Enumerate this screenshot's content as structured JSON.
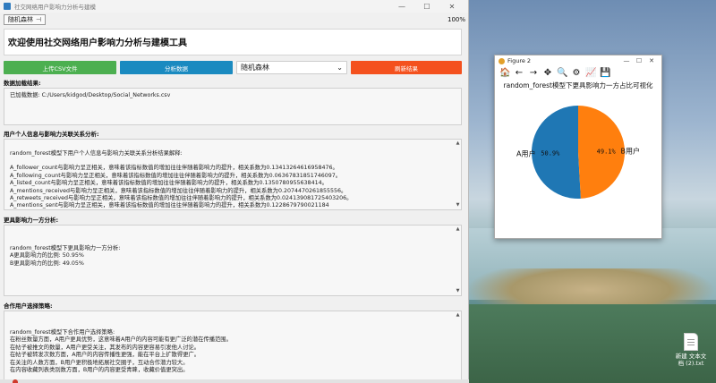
{
  "window": {
    "title": "社交网络用户影响力分析与建模",
    "minimize": "—",
    "maximize": "☐",
    "close": "✕"
  },
  "menubar": {
    "algo_label": "随机森林",
    "zoom": "100%"
  },
  "welcome": "欢迎使用社交网络用户影响力分析与建模工具",
  "buttons": {
    "upload": "上传CSV文件",
    "analyze": "分析数据",
    "select_value": "随机森林",
    "refresh": "刷新结果"
  },
  "sections": {
    "load": {
      "label": "数据加载结果:",
      "lines": [
        "已加载数据: C:/Users/kidgod/Desktop/Social_Networks.csv"
      ]
    },
    "relation": {
      "label": "用户个人信息与影响力关联关系分析:",
      "lines": [
        "random_forest模型下用户个人信息与影响力关联关系分析结果解释:",
        "",
        "A_follower_count与影响力呈正相关，意味着该指标数值的增加往往伴随着影响力的提升，相关系数为0.13413264616958476。",
        "A_following_count与影响力呈正相关，意味着该指标数值的增加往往伴随着影响力的提升，相关系数为0.06367831851746097。",
        "A_listed_count与影响力呈正相关，意味着该指标数值的增加往往伴随着影响力的提升，相关系数为0.1350780955638414。",
        "A_mentions_received与影响力呈正相关，意味着该指标数值的增加往往伴随着影响力的提升，相关系数为0.20744702618555​56。",
        "A_retweets_received与影响力呈正相关，意味着该指标数值的增加往往伴随着影响力的提升，相关系数为0.024139081725403206。",
        "A_mentions_sent与影响力呈正相关，意味着该指标数值的增加往往伴随着影响力的提升，相关系数为0.1228679790021184"
      ]
    },
    "influence": {
      "label": "更具影响力一方分析:",
      "lines": [
        "random_forest模型下更具影响力一方分析:",
        "A更具影响力的比例: 50.95%",
        "B更具影响力的比例: 49.05%"
      ]
    },
    "strategy": {
      "label": "合作用户选择策略:",
      "lines": [
        "random_forest模型下合作用户选择策略:",
        "在粉丝数量方面，A用户更具优势，这意味着A用户的内容可能有更广泛的潜在传播范围。",
        "在帖子被推文的数量，A用户更受关注，其发布的内容更容易引发他人讨论。",
        "在帖子被转发次数方面，A用户的内容传播性更强，能在平台上扩散得更广。",
        "在关注的人数方面，B用户更积极地拓展社交圈子，互动合作潜力较大。",
        "在内容收藏列表类别数方面，B用户的内容更受青睐，收藏价值更突出。"
      ]
    }
  },
  "figure": {
    "title": "Figure 2",
    "minimize": "—",
    "maximize": "☐",
    "close": "✕",
    "toolbar": [
      "🏠",
      "←",
      "→",
      "✥",
      "🔍",
      "⚙",
      "📈",
      "💾"
    ]
  },
  "chart_data": {
    "type": "pie",
    "title": "random_forest模型下更具影响力一方占比可视化",
    "categories": [
      "A用户",
      "B用户"
    ],
    "values": [
      50.9,
      49.1
    ],
    "value_labels": [
      "50.9%",
      "49.1%"
    ],
    "colors": [
      "#1f77b4",
      "#ff7f0e"
    ]
  },
  "desktop": {
    "icon_label": "新建 文本文档 (2).txt"
  }
}
